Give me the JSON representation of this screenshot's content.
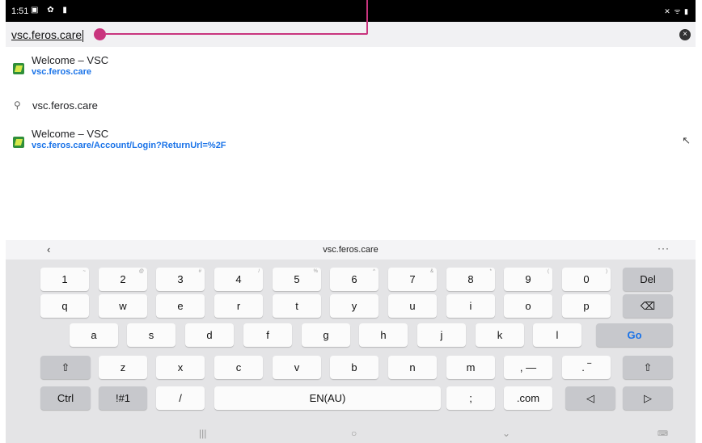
{
  "status": {
    "time": "1:51",
    "left_icons": "▣ ✿ ▮",
    "right_icons": "✕ ᯤ ▮"
  },
  "urlbar": {
    "value": "vsc.feros.care",
    "clear_icon": "×"
  },
  "suggestions": [
    {
      "title": "Welcome – VSC",
      "url": "vsc.feros.care"
    },
    {
      "search": "vsc.feros.care"
    },
    {
      "title": "Welcome – VSC",
      "url": "vsc.feros.care/Account/Login?ReturnUrl=%2F",
      "arrow": "↖"
    }
  ],
  "keyboard": {
    "back": "‹",
    "suggestion": "vsc.feros.care",
    "more": "···",
    "row1": [
      {
        "k": "1",
        "h": "~"
      },
      {
        "k": "2",
        "h": "@"
      },
      {
        "k": "3",
        "h": "#"
      },
      {
        "k": "4",
        "h": "/"
      },
      {
        "k": "5",
        "h": "%"
      },
      {
        "k": "6",
        "h": "^"
      },
      {
        "k": "7",
        "h": "&"
      },
      {
        "k": "8",
        "h": "*"
      },
      {
        "k": "9",
        "h": "("
      },
      {
        "k": "0",
        "h": ")"
      },
      {
        "k": "Del",
        "h": ""
      }
    ],
    "row2": [
      "q",
      "w",
      "e",
      "r",
      "t",
      "y",
      "u",
      "i",
      "o",
      "p",
      "⌫"
    ],
    "row3": [
      "a",
      "s",
      "d",
      "f",
      "g",
      "h",
      "j",
      "k",
      "l",
      "Go"
    ],
    "row4": [
      "⇧",
      "z",
      "x",
      "c",
      "v",
      "b",
      "n",
      "m",
      ", —",
      ". ‾",
      "⇧"
    ],
    "row5": [
      "Ctrl",
      "!#1",
      "/",
      "EN(AU)",
      ";",
      ".com",
      "◁",
      "▷"
    ]
  },
  "nav": {
    "recent": "|||",
    "home": "○",
    "back": "⌄",
    "keyboard": "⌨"
  }
}
